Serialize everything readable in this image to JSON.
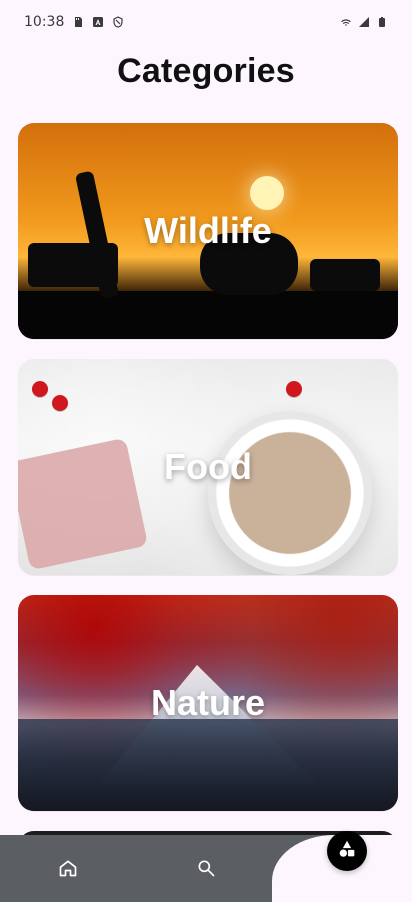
{
  "status_bar": {
    "time": "10:38",
    "left_icons": [
      "sd-card-icon",
      "a-icon",
      "shield-icon"
    ],
    "right_icons": [
      "wifi-icon",
      "signal-icon",
      "battery-icon"
    ]
  },
  "page": {
    "title": "Categories"
  },
  "categories": [
    {
      "label": "Wildlife",
      "name": "wildlife"
    },
    {
      "label": "Food",
      "name": "food"
    },
    {
      "label": "Nature",
      "name": "nature"
    }
  ],
  "bottom_nav": {
    "items": [
      {
        "name": "home",
        "icon": "home-icon"
      },
      {
        "name": "search",
        "icon": "search-icon"
      }
    ],
    "fab_icon": "shapes-icon"
  },
  "colors": {
    "background": "#fdf6ff",
    "bottom_nav": "#5b5f63",
    "fab": "#000000"
  }
}
